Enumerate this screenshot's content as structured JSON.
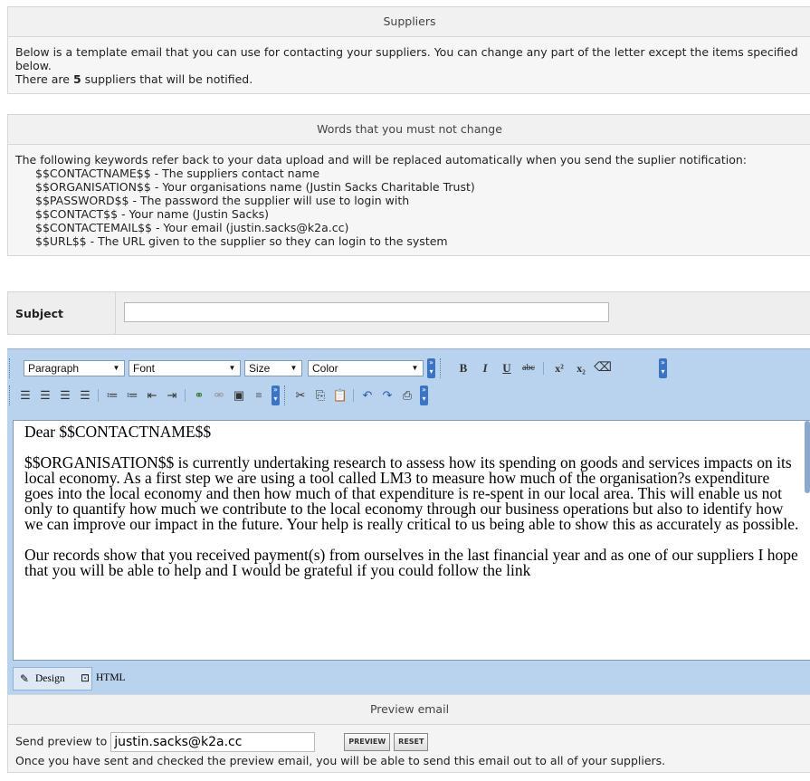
{
  "suppliers_panel": {
    "title": "Suppliers",
    "line1": "Below is a template email that you can use for contacting your suppliers. You can change any part of the letter except the items specified below.",
    "count_prefix": "There are ",
    "count": "5",
    "count_suffix": " suppliers that will be notified."
  },
  "keywords_panel": {
    "title": "Words that you must not change",
    "intro": "The following keywords refer back to your data upload and will be replaced automatically when you send the suplier notification:",
    "keywords": [
      "$$CONTACTNAME$$ - The suppliers contact name",
      "$$ORGANISATION$$ - Your organisations name (Justin Sacks Charitable Trust)",
      "$$PASSWORD$$ - The password the supplier will use to login with",
      "$$CONTACT$$ - Your name (Justin Sacks)",
      "$$CONTACTEMAIL$$ - Your email (justin.sacks@k2a.cc)",
      "$$URL$$ - The URL given to the supplier so they can login to the system"
    ]
  },
  "subject": {
    "label": "Subject",
    "value": ""
  },
  "toolbar": {
    "paragraph": "Paragraph",
    "font": "Font",
    "size": "Size",
    "color": "Color",
    "bold": "B",
    "italic": "I",
    "underline": "U",
    "strike": "abc",
    "superscript": "x²",
    "subscript": "x₂"
  },
  "editor": {
    "greeting": "Dear $$CONTACTNAME$$",
    "para1": "$$ORGANISATION$$ is currently undertaking research to assess how its spending on goods and services impacts on its local economy. As a first step we are using a tool called LM3 to measure how much of the organisation?s expenditure goes into the local economy and then how much of that expenditure is re-spent in our local area. This will enable us not only to quantify how much we contribute to the local economy through our business operations but also to identify how we can improve our impact in the future. Your help is really critical to us being able to show this as accurately as possible.",
    "para2": "Our records show that you received payment(s) from ourselves in the last financial year and as one of our suppliers I hope that you will be able to help and I would be grateful if you could follow the link"
  },
  "mode_tabs": {
    "design": "Design",
    "html": "HTML"
  },
  "preview_panel": {
    "title": "Preview email",
    "send_label": "Send preview to",
    "email": "justin.sacks@k2a.cc",
    "preview_btn": "PREVIEW",
    "reset_btn": "RESET",
    "note": "Once you have sent and checked the preview email, you will be able to send this email out to all of your suppliers."
  }
}
